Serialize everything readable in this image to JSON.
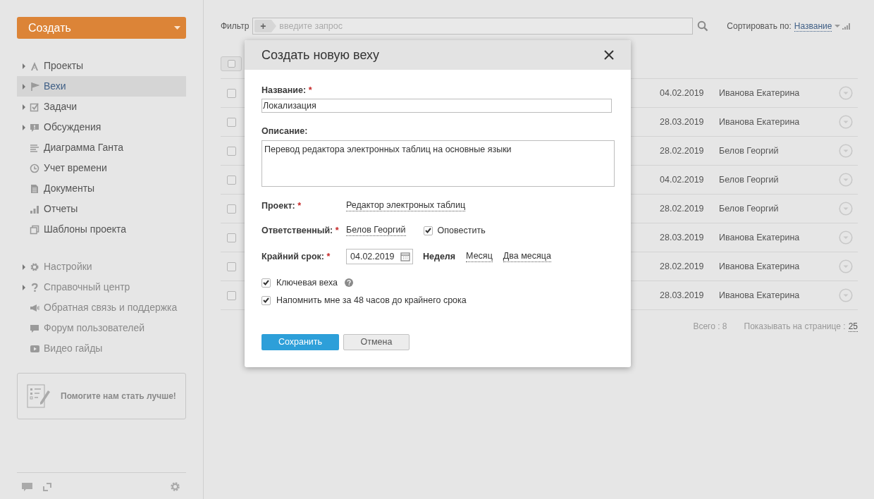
{
  "sidebar": {
    "create_button": "Создать",
    "nav": [
      {
        "label": "Проекты",
        "expandable": true,
        "selected": false
      },
      {
        "label": "Вехи",
        "expandable": true,
        "selected": true
      },
      {
        "label": "Задачи",
        "expandable": true,
        "selected": false
      },
      {
        "label": "Обсуждения",
        "expandable": true,
        "selected": false
      },
      {
        "label": "Диаграмма Ганта",
        "expandable": false,
        "selected": false
      },
      {
        "label": "Учет времени",
        "expandable": false,
        "selected": false
      },
      {
        "label": "Документы",
        "expandable": false,
        "selected": false
      },
      {
        "label": "Отчеты",
        "expandable": false,
        "selected": false
      },
      {
        "label": "Шаблоны проекта",
        "expandable": false,
        "selected": false
      }
    ],
    "help_nav": [
      {
        "label": "Настройки",
        "expandable": true
      },
      {
        "label": "Справочный центр",
        "expandable": true
      },
      {
        "label": "Обратная связь и поддержка",
        "expandable": false
      },
      {
        "label": "Форум пользователей",
        "expandable": false
      },
      {
        "label": "Видео гайды",
        "expandable": false
      }
    ],
    "feedback_card": "Помогите нам стать лучше!"
  },
  "toolbar": {
    "filter_label": "Фильтр",
    "filter_add": "+",
    "search_placeholder": "введите запрос",
    "sort_label": "Сортировать по:",
    "sort_value": "Название"
  },
  "table": {
    "header_checked": false,
    "rows": [
      {
        "checked": false,
        "deadline": "04.02.2019",
        "responsible": "Иванова Екатерина"
      },
      {
        "checked": false,
        "deadline": "28.03.2019",
        "responsible": "Иванова Екатерина"
      },
      {
        "checked": false,
        "deadline": "28.02.2019",
        "responsible": "Белов Георгий"
      },
      {
        "checked": false,
        "deadline": "04.02.2019",
        "responsible": "Белов Георгий"
      },
      {
        "checked": false,
        "deadline": "28.02.2019",
        "responsible": "Белов Георгий"
      },
      {
        "checked": false,
        "deadline": "28.03.2019",
        "responsible": "Иванова Екатерина"
      },
      {
        "checked": false,
        "deadline": "28.02.2019",
        "responsible": "Иванова Екатерина"
      },
      {
        "checked": false,
        "deadline": "28.03.2019",
        "responsible": "Иванова Екатерина"
      }
    ]
  },
  "footer": {
    "total": "Всего : 8",
    "per_page_label": "Показывать на странице :",
    "per_page": "25"
  },
  "dialog": {
    "title": "Создать новую веху",
    "name": {
      "label": "Название:",
      "mark": "*",
      "value": "Локализация"
    },
    "description": {
      "label": "Описание:",
      "value": "Перевод редактора электронных таблиц на основные языки"
    },
    "project": {
      "label": "Проект:",
      "mark": "*",
      "value": "Редактор электроных таблиц"
    },
    "responsible": {
      "label": "Ответственный:",
      "mark": "*",
      "value": "Белов Георгий"
    },
    "notify": {
      "label": "Оповестить",
      "checked": true
    },
    "deadline": {
      "label": "Крайний срок:",
      "mark": "*",
      "value": "04.02.2019"
    },
    "presets": [
      {
        "label": "Неделя",
        "selected": true
      },
      {
        "label": "Месяц",
        "selected": false
      },
      {
        "label": "Два месяца",
        "selected": false
      }
    ],
    "options": [
      {
        "label": "Ключевая веха",
        "checked": true,
        "help": true
      },
      {
        "label": "Напомнить мне за 48 часов до крайнего срока",
        "checked": true,
        "help": false
      }
    ],
    "save": "Сохранить",
    "cancel": "Отмена"
  }
}
